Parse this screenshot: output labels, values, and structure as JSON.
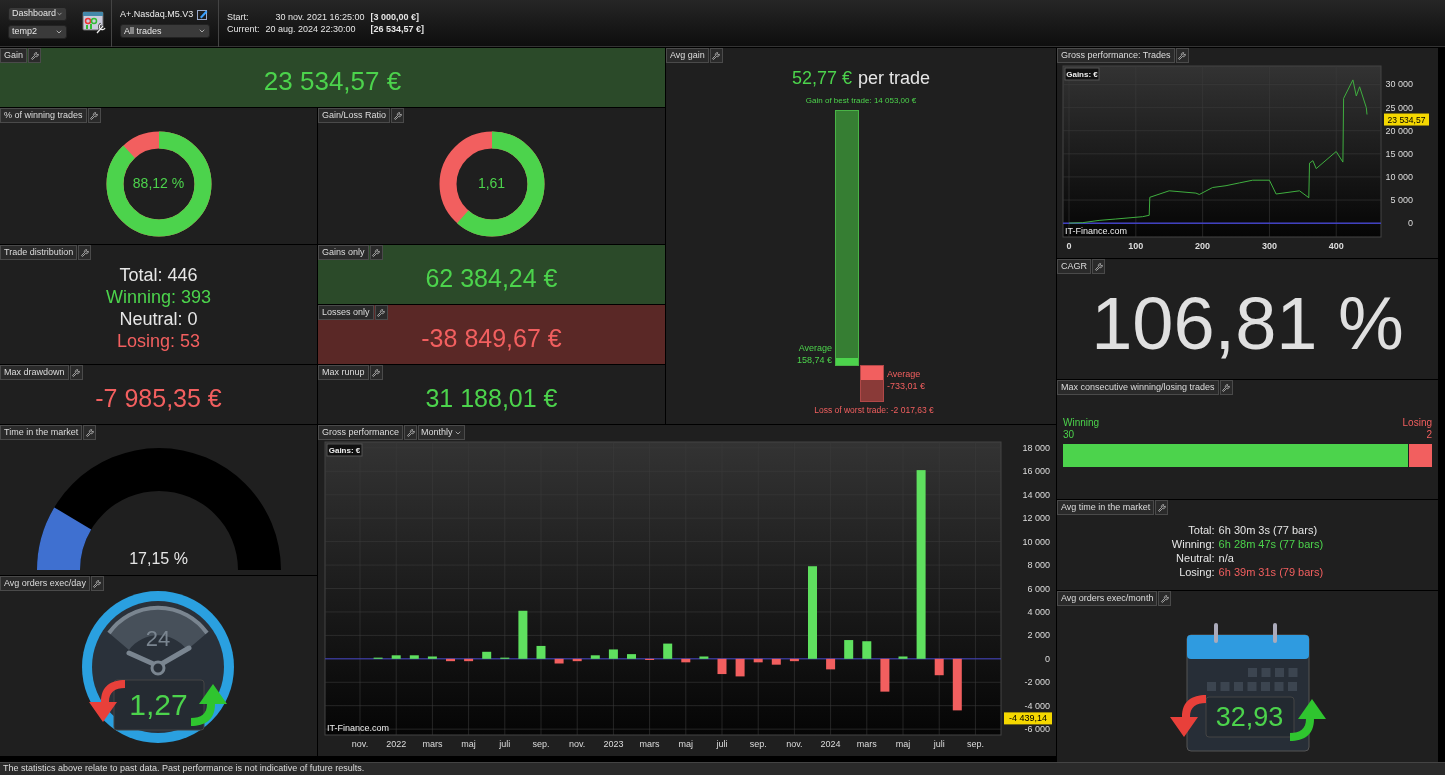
{
  "toolbar": {
    "view_select": "Dashboard",
    "template_select": "temp2",
    "strategy_name": "A+.Nasdaq.M5.V3",
    "trade_filter": "All trades",
    "start_label": "Start:",
    "start_date": "30 nov. 2021 16:25:00",
    "start_capital": "[3 000,00 €]",
    "current_label": "Current:",
    "current_date": "20 aug. 2024 22:30:00",
    "current_capital": "[26 534,57 €]"
  },
  "gain": {
    "title": "Gain",
    "value": "23 534,57 €"
  },
  "winning_trades": {
    "title": "% of winning trades",
    "value": "88,12 %",
    "level": 0.8812
  },
  "gain_loss_ratio": {
    "title": "Gain/Loss Ratio",
    "value": "1,61",
    "level": 0.616
  },
  "trade_distribution": {
    "title": "Trade distribution",
    "rows": [
      {
        "kind": "total",
        "label": "Total:",
        "value": "446"
      },
      {
        "kind": "winning",
        "label": "Winning:",
        "value": "393"
      },
      {
        "kind": "neutral",
        "label": "Neutral:",
        "value": "0"
      },
      {
        "kind": "losing",
        "label": "Losing:",
        "value": "53"
      }
    ]
  },
  "gains_only": {
    "title": "Gains only",
    "value": "62 384,24 €"
  },
  "losses_only": {
    "title": "Losses only",
    "value": "-38 849,67 €"
  },
  "max_drawdown": {
    "title": "Max drawdown",
    "value": "-7 985,35 €"
  },
  "max_runup": {
    "title": "Max runup",
    "value": "31 188,01 €"
  },
  "avg_gain": {
    "title": "Avg gain",
    "value": "52,77 €",
    "suffix": "per trade",
    "best_trade": "Gain of best trade: 14 053,00 €",
    "avg_win_label": "Average",
    "avg_win_value": "158,74 €",
    "avg_loss_label": "Average",
    "avg_loss_value": "-733,01 €",
    "worst_trade": "Loss of worst trade: -2 017,63 €"
  },
  "time_in_market": {
    "title": "Time in the market",
    "value": "17,15 %",
    "level": 0.1715
  },
  "avg_orders_day": {
    "title": "Avg orders exec/day",
    "clock_label": "24",
    "value": "1,27"
  },
  "gross_performance_monthly": {
    "title": "Gross performance",
    "period_select": "Monthly",
    "source": "IT-Finance.com",
    "chart_data": {
      "type": "bar",
      "categories": [
        "nov.",
        null,
        "2022",
        null,
        "mars",
        null,
        "maj",
        null,
        "juli",
        null,
        "sep.",
        null,
        "nov.",
        null,
        "2023",
        null,
        "mars",
        null,
        "maj",
        null,
        "juli",
        null,
        "sep.",
        null,
        "nov.",
        null,
        "2024",
        null,
        "mars",
        null,
        "maj",
        null,
        "juli",
        null,
        "sep."
      ],
      "series": [
        {
          "name": "Gains: €",
          "color": "#5fe05f",
          "values": [
            null,
            100,
            300,
            300,
            200,
            null,
            null,
            600,
            100,
            4100,
            1100,
            null,
            null,
            300,
            800,
            400,
            null,
            1300,
            null,
            200,
            null,
            null,
            null,
            null,
            null,
            7900,
            null,
            1600,
            1500,
            null,
            200,
            16100,
            null,
            null,
            null
          ]
        },
        {
          "color": "#f25f5f",
          "values": [
            null,
            null,
            null,
            null,
            null,
            -200,
            -200,
            null,
            null,
            null,
            null,
            -400,
            -200,
            null,
            null,
            null,
            -100,
            null,
            -300,
            null,
            -1300,
            -1500,
            -300,
            -500,
            -200,
            null,
            -900,
            null,
            null,
            -2800,
            null,
            null,
            -1400,
            -4400,
            null
          ]
        }
      ],
      "stacked": true,
      "ref_lines": [
        {
          "axis": "y",
          "value": 0,
          "color": "#4040c0"
        }
      ],
      "yticks": [
        {
          "value": -6000,
          "label": "-6 000"
        },
        {
          "value": -4000,
          "label": "-4 000"
        },
        {
          "value": -2000,
          "label": "-2 000"
        },
        {
          "value": 0,
          "label": "0"
        },
        {
          "value": 2000,
          "label": "2 000"
        },
        {
          "value": 4000,
          "label": "4 000"
        },
        {
          "value": 6000,
          "label": "6 000"
        },
        {
          "value": 8000,
          "label": "8 000"
        },
        {
          "value": 10000,
          "label": "10 000"
        },
        {
          "value": 12000,
          "label": "12 000"
        },
        {
          "value": 14000,
          "label": "14 000"
        },
        {
          "value": 16000,
          "label": "16 000"
        },
        {
          "value": 18000,
          "label": "18 000"
        }
      ],
      "ylim": [
        -6500,
        18500
      ],
      "grid": true,
      "annotations": [
        "-4 439,14"
      ]
    }
  },
  "gross_performance_trades": {
    "title": "Gross performance: Trades",
    "source": "IT-Finance.com",
    "chart_data": {
      "type": "line",
      "x": [
        0,
        20,
        45,
        70,
        110,
        120,
        121,
        150,
        190,
        195,
        215,
        235,
        255,
        275,
        300,
        310,
        345,
        359,
        360,
        365,
        370,
        400,
        410,
        411,
        425,
        430,
        435,
        445,
        446
      ],
      "series": [
        {
          "name": "Gains: €",
          "color": "#3fae3f",
          "values": [
            0,
            100,
            600,
            900,
            1400,
            1700,
            5600,
            7000,
            6500,
            6200,
            7700,
            8100,
            8700,
            9300,
            9300,
            6300,
            7000,
            5500,
            13000,
            13500,
            11800,
            15500,
            13200,
            27000,
            31000,
            27500,
            29500,
            25000,
            23500
          ]
        }
      ],
      "xticks": [
        0,
        100,
        200,
        300,
        400
      ],
      "xlim": [
        -9,
        467
      ],
      "yticks": [
        {
          "value": 0,
          "label": "0"
        },
        {
          "value": 5000,
          "label": "5 000"
        },
        {
          "value": 10000,
          "label": "10 000"
        },
        {
          "value": 15000,
          "label": "15 000"
        },
        {
          "value": 20000,
          "label": "20 000"
        },
        {
          "value": 25000,
          "label": "25 000"
        },
        {
          "value": 30000,
          "label": "30 000"
        }
      ],
      "ylim": [
        -3000,
        34000
      ],
      "ref_lines": [
        {
          "axis": "y",
          "value": 0,
          "color": "#4040c0"
        }
      ],
      "grid": true,
      "annotations": [
        "23 534,57"
      ]
    }
  },
  "cagr": {
    "title": "CAGR",
    "value": "106,81 %"
  },
  "max_consecutive": {
    "title": "Max consecutive winning/losing trades",
    "winning_label": "Winning",
    "winning_value": "30",
    "losing_label": "Losing",
    "losing_value": "2",
    "level": 0.9375
  },
  "avg_time_in_market": {
    "title": "Avg time in the market",
    "rows": [
      {
        "kind": "total",
        "label": "Total:",
        "value": "6h 30m 3s (77 bars)"
      },
      {
        "kind": "winning",
        "label": "Winning:",
        "value": "6h 28m 47s (77 bars)"
      },
      {
        "kind": "neutral",
        "label": "Neutral:",
        "value": "n/a"
      },
      {
        "kind": "losing",
        "label": "Losing:",
        "value": "6h 39m 31s (79 bars)"
      }
    ]
  },
  "avg_orders_month": {
    "title": "Avg orders exec/month",
    "value": "32,93"
  },
  "footer": {
    "disclaimer": "The statistics above relate to past data. Past performance is not indicative of future results."
  }
}
